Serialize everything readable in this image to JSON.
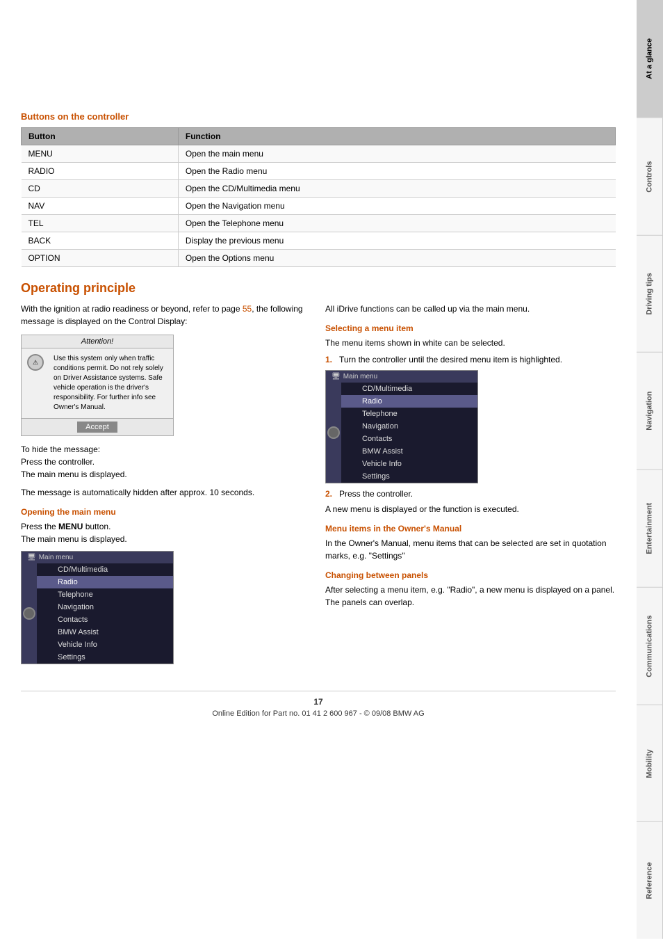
{
  "page": {
    "number": "17",
    "footer_text": "Online Edition for Part no. 01 41 2 600 967  -  © 09/08 BMW AG"
  },
  "side_tabs": [
    {
      "id": "at-a-glance",
      "label": "At a glance",
      "active": true
    },
    {
      "id": "controls",
      "label": "Controls",
      "active": false
    },
    {
      "id": "driving-tips",
      "label": "Driving tips",
      "active": false
    },
    {
      "id": "navigation",
      "label": "Navigation",
      "active": false
    },
    {
      "id": "entertainment",
      "label": "Entertainment",
      "active": false
    },
    {
      "id": "communications",
      "label": "Communications",
      "active": false
    },
    {
      "id": "mobility",
      "label": "Mobility",
      "active": false
    },
    {
      "id": "reference",
      "label": "Reference",
      "active": false
    }
  ],
  "buttons_section": {
    "title": "Buttons on the controller",
    "table": {
      "headers": [
        "Button",
        "Function"
      ],
      "rows": [
        [
          "MENU",
          "Open the main menu"
        ],
        [
          "RADIO",
          "Open the Radio menu"
        ],
        [
          "CD",
          "Open the CD/Multimedia menu"
        ],
        [
          "NAV",
          "Open the Navigation menu"
        ],
        [
          "TEL",
          "Open the Telephone menu"
        ],
        [
          "BACK",
          "Display the previous menu"
        ],
        [
          "OPTION",
          "Open the Options menu"
        ]
      ]
    }
  },
  "operating_principle": {
    "title": "Operating principle",
    "intro_text": "With the ignition at radio readiness or beyond, refer to page 55, the following message is displayed on the Control Display:",
    "intro_link_text": "55",
    "attention_box": {
      "header": "Attention!",
      "text": "Use this system only when traffic conditions permit. Do not rely solely on Driver Assistance systems. Safe vehicle operation is the driver's responsibility. For further info see Owner's Manual.",
      "accept_label": "Accept"
    },
    "hide_message_text": "To hide the message:\nPress the controller.\nThe main menu is displayed.",
    "auto_hide_text": "The message is automatically hidden after approx. 10 seconds.",
    "opening_main_menu": {
      "title": "Opening the main menu",
      "text": "Press the MENU button.\nThe main menu is displayed.",
      "bold_word": "MENU"
    },
    "main_menu_items": [
      "CD/Multimedia",
      "Radio",
      "Telephone",
      "Navigation",
      "Contacts",
      "BMW Assist",
      "Vehicle Info",
      "Settings"
    ],
    "right_col": {
      "intro": "All iDrive functions can be called up via the main menu.",
      "selecting_title": "Selecting a menu item",
      "selecting_text": "The menu items shown in white can be selected.",
      "step1": "Turn the controller until the desired menu item is highlighted.",
      "step2": "Press the controller.",
      "step2_result": "A new menu is displayed or the function is executed.",
      "menu_items_title": "Menu items in the Owner's Manual",
      "menu_items_text": "In the Owner's Manual, menu items that can be selected are set in quotation marks, e.g. \"Settings\"",
      "changing_panels_title": "Changing between panels",
      "changing_panels_text": "After selecting a menu item, e.g. \"Radio\", a new menu is displayed on a panel. The panels can overlap."
    }
  }
}
